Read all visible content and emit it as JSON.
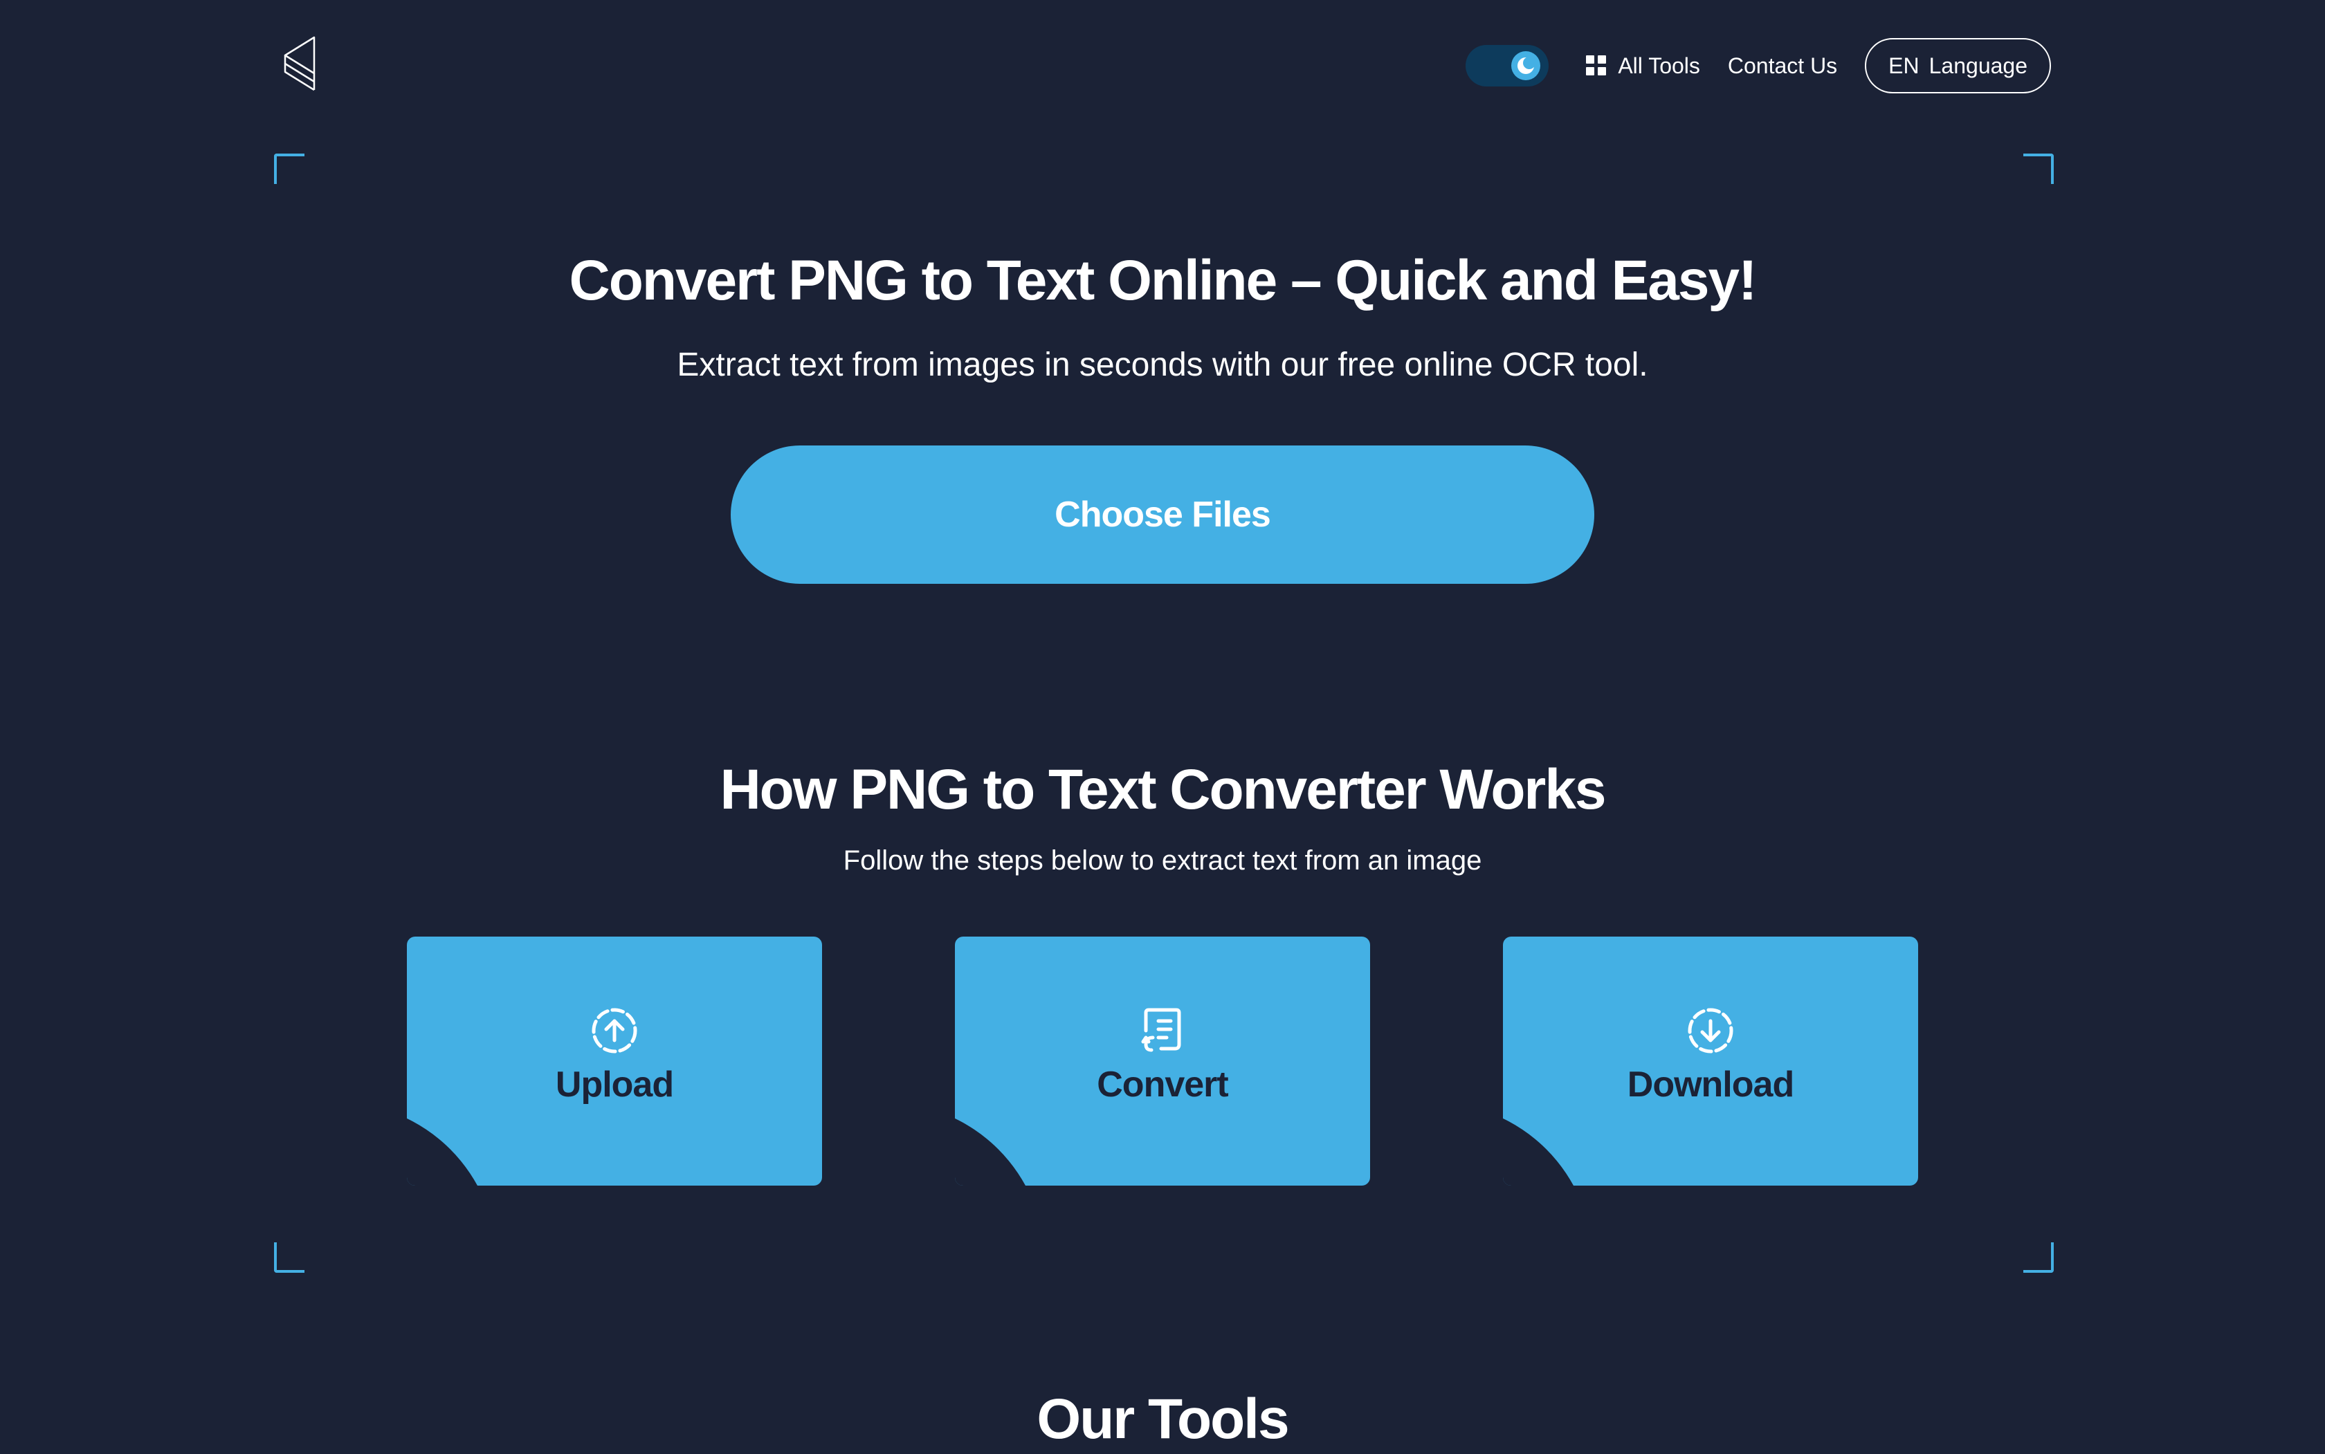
{
  "header": {
    "nav": {
      "all_tools": "All Tools",
      "contact_us": "Contact Us",
      "language_code": "EN",
      "language_label": "Language"
    },
    "theme_toggle": "dark"
  },
  "hero": {
    "title": "Convert PNG to Text Online – Quick and Easy!",
    "subtitle": "Extract text from images in seconds with our free online OCR tool.",
    "choose_files": "Choose Files"
  },
  "how_it_works": {
    "title": "How PNG to Text Converter Works",
    "subtitle": "Follow the steps below to extract text from an image",
    "steps": [
      {
        "label": "Upload",
        "icon": "upload-icon"
      },
      {
        "label": "Convert",
        "icon": "convert-document-icon"
      },
      {
        "label": "Download",
        "icon": "download-icon"
      }
    ]
  },
  "tools": {
    "title": "Our Tools"
  },
  "colors": {
    "background": "#1b2236",
    "accent": "#44b0e4",
    "toggle_track": "#0d3b5c",
    "text": "#ffffff"
  }
}
